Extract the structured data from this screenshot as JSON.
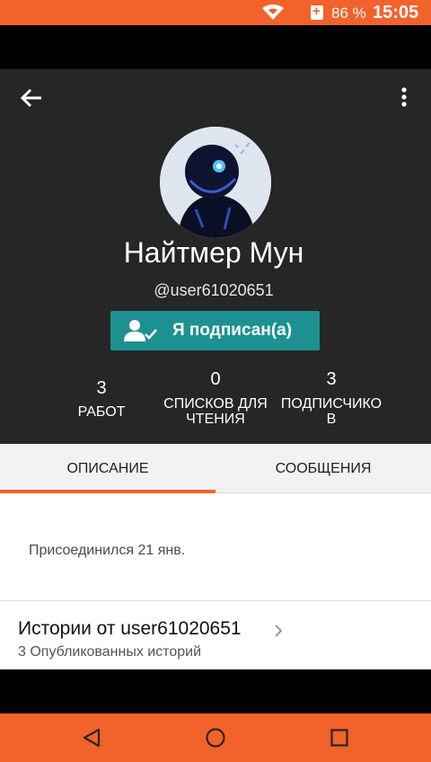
{
  "status_bar": {
    "battery": "86 %",
    "time": "15:05"
  },
  "profile": {
    "display_name": "Найтмер Мун",
    "username": "@user61020651",
    "follow_button": "Я подписан(а)",
    "stats": [
      {
        "value": "3",
        "label": "РАБОТ"
      },
      {
        "value": "0",
        "label": "СПИСКОВ ДЛЯ ЧТЕНИЯ"
      },
      {
        "value": "3",
        "label": "ПОДПИСЧИКО В"
      }
    ]
  },
  "tabs": [
    {
      "label": "ОПИСАНИЕ",
      "active": true
    },
    {
      "label": "СООБЩЕНИЯ",
      "active": false
    }
  ],
  "about": {
    "joined": "Присоединился 21 янв.",
    "stories_title": "Истории от user61020651",
    "stories_count": "3 Опубликованных историй"
  },
  "colors": {
    "accent": "#f2622b",
    "follow": "#1d9191",
    "header": "#262626"
  },
  "icons": [
    "wifi-icon",
    "sim-icon",
    "back-arrow-icon",
    "more-vert-icon",
    "person-check-icon",
    "chevron-right-icon",
    "nav-back-icon",
    "nav-home-icon",
    "nav-recents-icon"
  ]
}
